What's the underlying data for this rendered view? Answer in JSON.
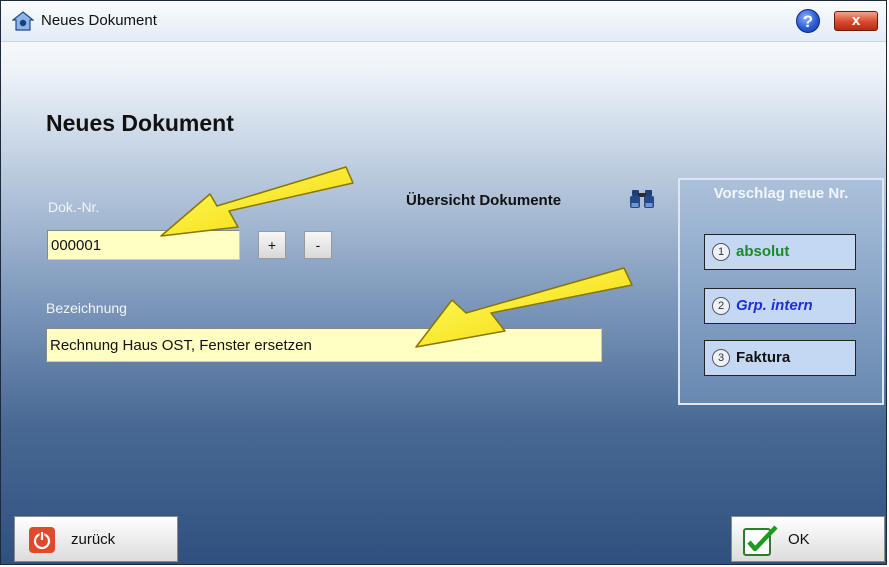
{
  "window": {
    "title": "Neues Dokument",
    "help_label": "?",
    "close_label": "x"
  },
  "form": {
    "heading": "Neues Dokument",
    "doknr_label": "Dok.-Nr.",
    "doknr_value": "000001",
    "plus_label": "+",
    "minus_label": "-",
    "overview_label": "Übersicht Dokumente",
    "bezeichnung_label": "Bezeichnung",
    "bezeichnung_value": "Rechnung Haus OST, Fenster ersetzen"
  },
  "suggestion": {
    "title": "Vorschlag neue Nr.",
    "buttons": [
      {
        "num": "1",
        "label": "absolut",
        "color": "#1c8a2a"
      },
      {
        "num": "2",
        "label": "Grp. intern",
        "color": "#1f2fd6"
      },
      {
        "num": "3",
        "label": "Faktura",
        "color": "#111111"
      }
    ]
  },
  "footer": {
    "back_label": "zurück",
    "ok_label": "OK"
  },
  "icons": [
    "app-icon",
    "help-icon",
    "close-icon",
    "binoculars-icon",
    "power-icon",
    "checkmark-icon",
    "arrow-annotation"
  ]
}
